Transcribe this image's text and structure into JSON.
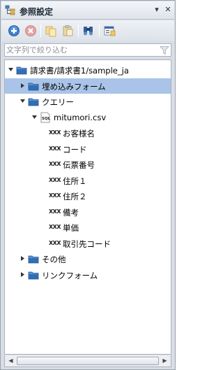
{
  "window": {
    "title": "参照設定",
    "pin_glyph": "▾",
    "close_glyph": "✕"
  },
  "toolbar": {
    "buttons": [
      {
        "name": "add-icon"
      },
      {
        "name": "remove-icon"
      },
      {
        "name": "copy-icon"
      },
      {
        "name": "paste-icon"
      },
      {
        "name": "binoculars-icon"
      },
      {
        "name": "properties-icon"
      }
    ]
  },
  "filter": {
    "placeholder": "文字列で絞り込む",
    "value": ""
  },
  "tree": {
    "nodes": [
      {
        "label": "請求書/請求書1/sample_ja",
        "icon": "folder",
        "expanded": true,
        "depth": 0
      },
      {
        "label": "埋め込みフォーム",
        "icon": "folder",
        "expanded": false,
        "depth": 1,
        "selected": true
      },
      {
        "label": "クエリー",
        "icon": "folder",
        "expanded": true,
        "depth": 1
      },
      {
        "label": "mitumori.csv",
        "icon": "sql",
        "expanded": true,
        "depth": 2
      },
      {
        "label": "お客様名",
        "icon": "xxx",
        "depth": 3
      },
      {
        "label": "コード",
        "icon": "xxx",
        "depth": 3
      },
      {
        "label": "伝票番号",
        "icon": "xxx",
        "depth": 3
      },
      {
        "label": "住所１",
        "icon": "xxx",
        "depth": 3
      },
      {
        "label": "住所２",
        "icon": "xxx",
        "depth": 3
      },
      {
        "label": "備考",
        "icon": "xxx",
        "depth": 3
      },
      {
        "label": "単価",
        "icon": "xxx",
        "depth": 3
      },
      {
        "label": "取引先コード",
        "icon": "xxx",
        "depth": 3
      },
      {
        "label": "その他",
        "icon": "folder",
        "expanded": false,
        "depth": 1
      },
      {
        "label": "リンクフォーム",
        "icon": "folder",
        "expanded": false,
        "depth": 1
      }
    ],
    "field_icon_text": "XXX"
  },
  "scrollbar": {
    "left_glyph": "◀",
    "right_glyph": "▶"
  },
  "colors": {
    "selection": "#a9c4e8",
    "folder_blue": "#2f6fb3",
    "panel_bg": "#d9dee6"
  }
}
